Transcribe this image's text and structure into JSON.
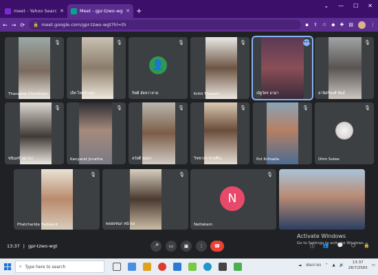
{
  "browser": {
    "tabs": [
      {
        "title": "meet - Yahoo Search Results",
        "fav_color": "#7b2ad1",
        "active": false
      },
      {
        "title": "Meet - gpr-tzwo-wgt",
        "fav_color": "#00a884",
        "active": true
      }
    ],
    "new_tab": "+",
    "url": "meet.google.com/gpr-tzwo-wgt?hl=th"
  },
  "participants": [
    {
      "name": "Thanawat Chantham"
    },
    {
      "name": "เอ็ท ไทยอ่านสา"
    },
    {
      "name": "กิตติ อัยหวาลาด",
      "initial": "",
      "avatar_color": "#2e9a4f"
    },
    {
      "name": "Kritti Thanom"
    },
    {
      "name": "ณัฐวัตร อาม่า"
    },
    {
      "name": "ลานิศร์พงศ์ พันธ์"
    },
    {
      "name": "ชนินทร์ อมานา"
    },
    {
      "name": "Kanyarat Jonatha"
    },
    {
      "name": "สวัสดิ์ พฤหา"
    },
    {
      "name": "วิชชากร ชายชีระ"
    },
    {
      "name": "Pot Kritsada"
    },
    {
      "name": "Ohm Sutee"
    },
    {
      "name": "Phatcharida Nadawut"
    },
    {
      "name": "พลอยชนก หน้าผง"
    },
    {
      "name": "Nattakarn",
      "initial": "N",
      "avatar_color": "#e8496a"
    },
    {
      "name": ""
    }
  ],
  "meeting": {
    "time": "13:37",
    "separator": "|",
    "code": "gpr-tzwo-wgt"
  },
  "watermark": {
    "line1": "Activate Windows",
    "line2": "Go to Settings to activate Windows."
  },
  "taskbar": {
    "search_placeholder": "Type here to search",
    "lang": "ฝนเบาลง",
    "time": "13:37",
    "date": "28/7/2565"
  }
}
